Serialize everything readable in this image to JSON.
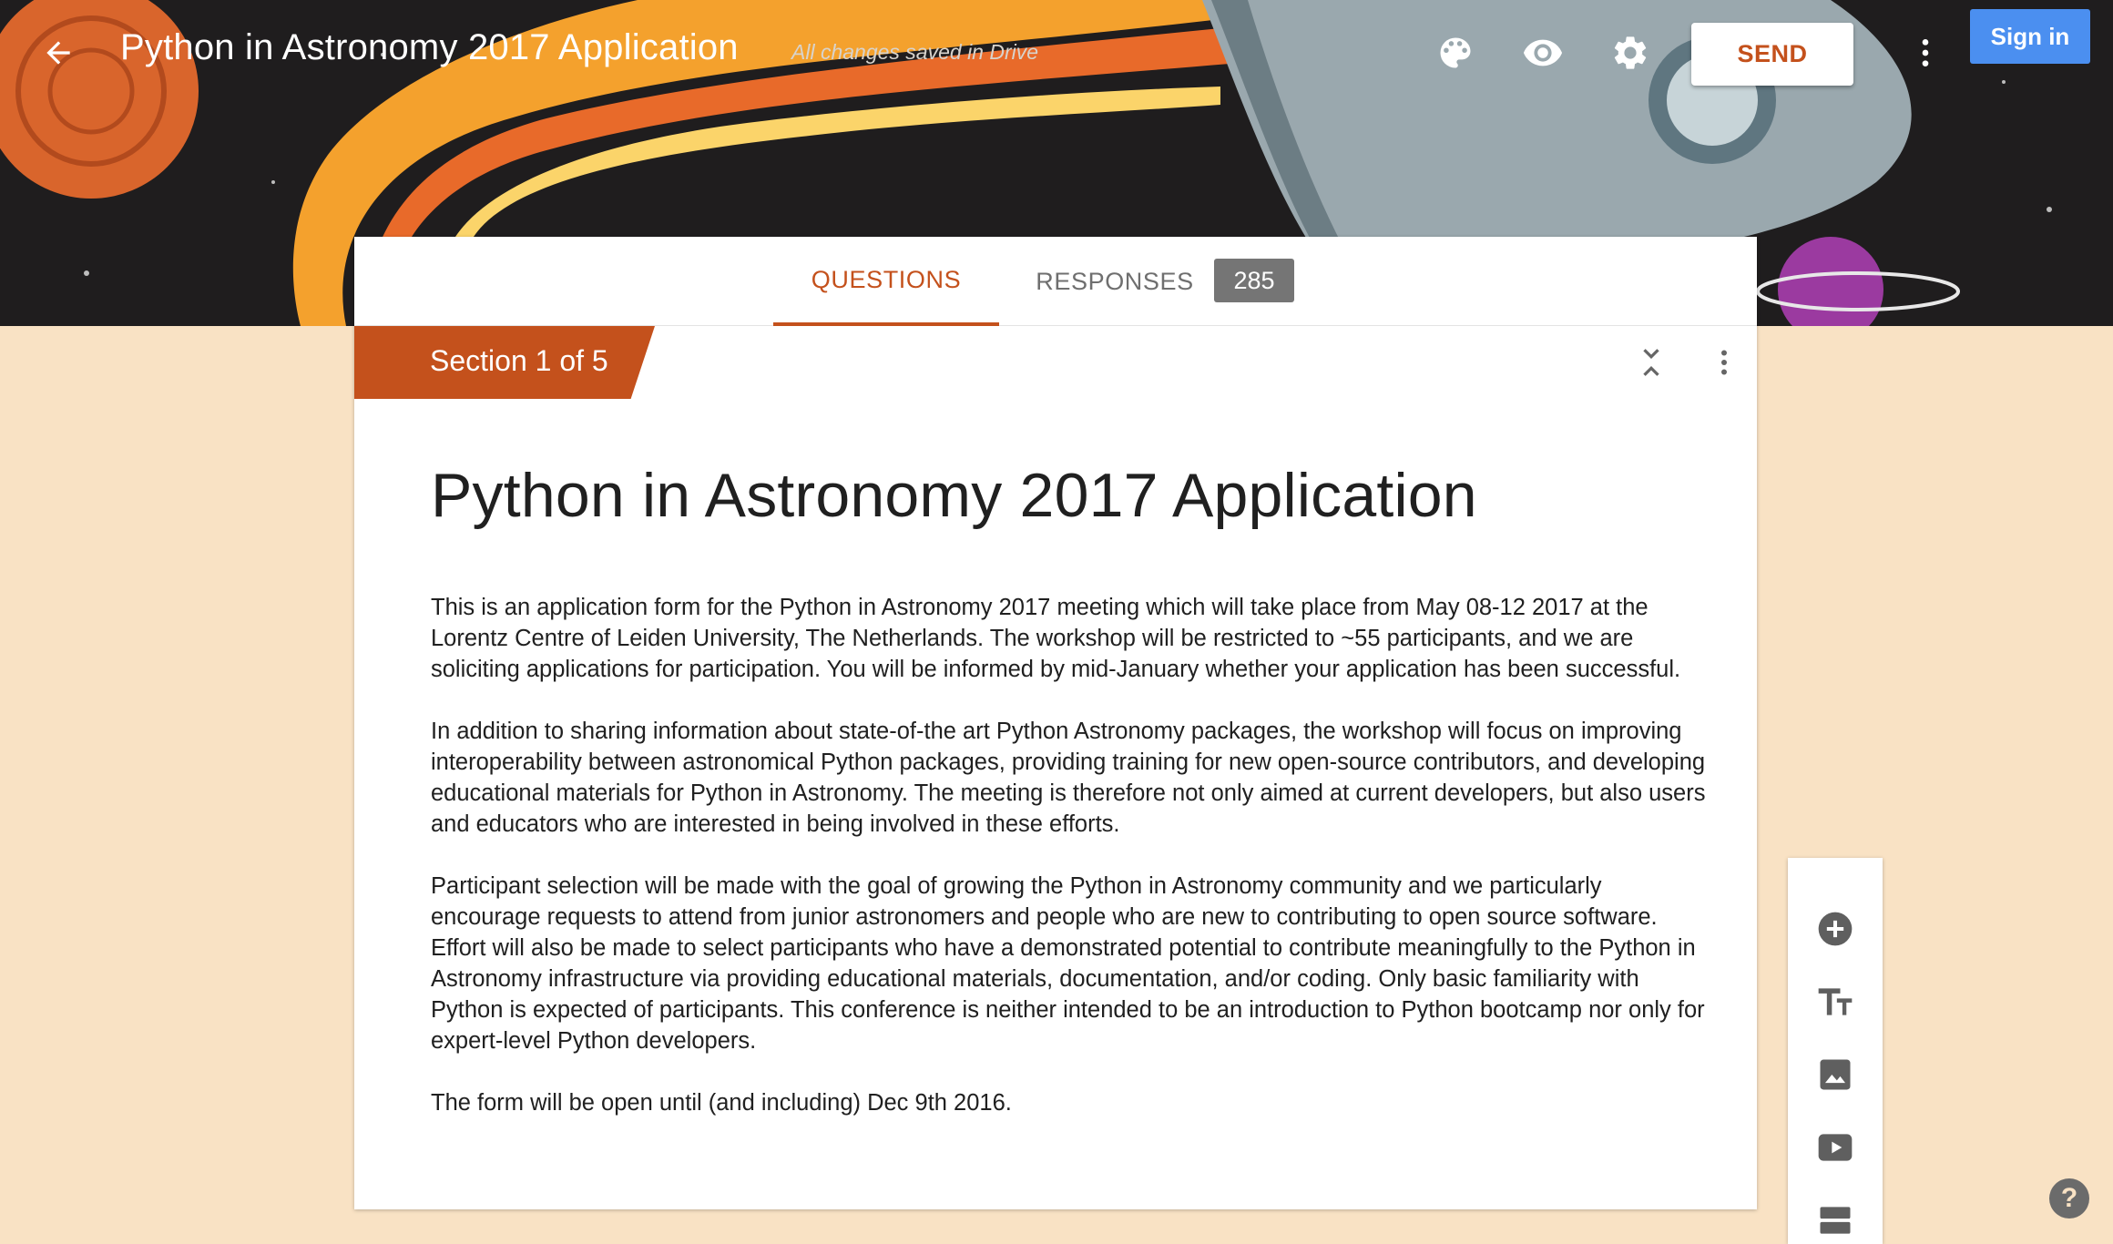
{
  "header": {
    "title": "Python in Astronomy 2017 Application",
    "save_status": "All changes saved in Drive",
    "send_label": "SEND",
    "signin_label": "Sign in",
    "icons": [
      "back-arrow-icon",
      "palette-icon",
      "eye-icon",
      "gear-icon",
      "more-vert-icon"
    ]
  },
  "tabs": {
    "questions_label": "QUESTIONS",
    "responses_label": "RESPONSES",
    "responses_count": "285"
  },
  "section": {
    "label": "Section 1 of 5"
  },
  "form": {
    "title": "Python in Astronomy 2017 Application",
    "paragraphs": [
      "This is an application form for the Python in Astronomy 2017 meeting which will take place from May 08-12 2017 at the Lorentz Centre of Leiden University, The Netherlands. The workshop will be restricted to ~55 participants, and we are soliciting applications for participation. You will be informed by mid-January whether your application has been successful.",
      "In addition to sharing information about state-of-the art Python Astronomy packages, the workshop will focus on improving interoperability between astronomical Python packages, providing training for new open-source contributors, and developing educational materials for Python in Astronomy. The meeting is therefore not only aimed at current developers, but also users and educators who are interested in being involved in these efforts.",
      "Participant selection will be made with the goal of growing the Python in Astronomy community and we particularly encourage requests to attend from junior astronomers and people who are new to contributing to open source software. Effort will also be made to select participants who have a demonstrated potential to contribute meaningfully to the Python in Astronomy infrastructure via providing educational materials, documentation, and/or coding. Only basic familiarity with Python is expected of participants. This conference is neither intended to be an introduction to Python bootcamp nor only for expert-level Python developers.",
      "The form will be open until (and including) Dec 9th 2016."
    ]
  },
  "toolbar": {
    "icons": [
      "add-question-icon",
      "add-title-icon",
      "add-image-icon",
      "add-video-icon",
      "add-section-icon"
    ]
  },
  "help": {
    "label": "?"
  },
  "colors": {
    "accent": "#c4511c",
    "page_background": "#f9e2c4",
    "signin_blue": "#4b8ff0",
    "count_badge": "#757575"
  }
}
